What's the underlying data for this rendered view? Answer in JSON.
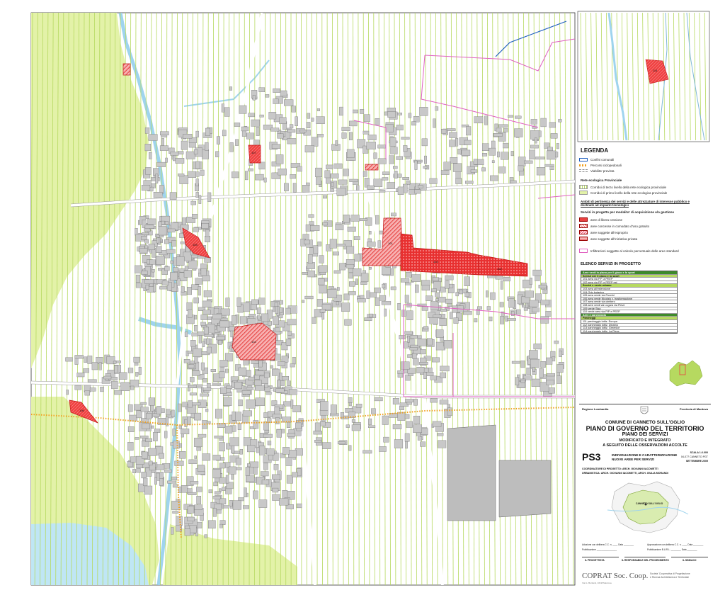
{
  "map": {
    "service_areas": [
      {
        "code": "101",
        "kind": "cessione"
      },
      {
        "code": "102",
        "kind": "cessione"
      },
      {
        "code": "103",
        "kind": "esproprio"
      },
      {
        "code": "104",
        "kind": "esproprio"
      },
      {
        "code": "105",
        "kind": "esproprio"
      },
      {
        "code": "106",
        "kind": "esproprio"
      },
      {
        "code": "107",
        "kind": "esproprio"
      },
      {
        "code": "108",
        "kind": "esproprio"
      },
      {
        "code": "109",
        "kind": "esproprio"
      },
      {
        "code": "110",
        "kind": "esproprio"
      },
      {
        "code": "111",
        "kind": "esproprio"
      },
      {
        "code": "112",
        "kind": "esproprio"
      },
      {
        "code": "113",
        "kind": "esproprio"
      },
      {
        "code": "114",
        "kind": "esproprio"
      }
    ]
  },
  "legend": {
    "title": "LEGENDA",
    "items": [
      {
        "label": "Confini comunali",
        "color": "#1f5fbf",
        "style": "line"
      },
      {
        "label": "Percorsi ciclopedonali",
        "color": "#f0a020",
        "style": "dots"
      },
      {
        "label": "Viabilita' prevista",
        "color": "#bbbbbb",
        "style": "dashed"
      }
    ],
    "ecological_heading": "Rete ecologica Provinciale",
    "ecological_items": [
      {
        "label": "Corridoi di terzo livello della rete ecologica provinciale",
        "color": "#b6d960"
      },
      {
        "label": "Corridoi di primo livello della rete ecologica provinciale",
        "color": "#e3f2a8"
      }
    ],
    "ambiti_heading": "Ambiti di pertinenza dei servizi e delle attrezzature di interesse pubblico e destinate ad impianti tecnologici",
    "servizi_heading": "Servizi in progetto per modalita' di acquisizione e/o gestione",
    "servizi_items": [
      {
        "label": "aree di libera cessione",
        "color": "#e94040"
      },
      {
        "label": "aree concesse in comodato d'uso gratuito",
        "color": "#f29a9a"
      },
      {
        "label": "aree soggette all'esproprio",
        "color": "#f2b5b5"
      },
      {
        "label": "aree soggette all'iniziativa privata",
        "color": "#f7c9c9"
      }
    ],
    "ambiti_standard_label": "Infiltrazioni soggette al calcolo percentuale delle aree standard",
    "ambiti_standard_color": "#e060c0"
  },
  "elenco": {
    "title": "ELENCO SERVIZI IN PROGETTO",
    "rows": [
      {
        "text": "Aree verdi in piano per il gioco e lo sport",
        "kind": "head-dark"
      },
      {
        "text": "Servizi per il gioco e lo sport",
        "kind": "head-light"
      },
      {
        "text": "101 area via P.P. a PEEP",
        "kind": "row"
      },
      {
        "text": "102 area via P.P. e PEEP est",
        "kind": "row"
      },
      {
        "text": "Servizi e verde urbano",
        "kind": "head-light"
      },
      {
        "text": "103 area all'estensione",
        "kind": "row"
      },
      {
        "text": "104 Orto botanico",
        "kind": "row"
      },
      {
        "text": "105 area verde via Puccini",
        "kind": "row"
      },
      {
        "text": "106 area verde Nicolgio v. trasformazione",
        "kind": "row"
      },
      {
        "text": "107 area verde via cimitero",
        "kind": "row"
      },
      {
        "text": "108 aree verdi via Lugura via Pieve",
        "kind": "row"
      },
      {
        "text": "109 verde Sisa",
        "kind": "row"
      },
      {
        "text": "110 verde area via PIP e PEEP",
        "kind": "row"
      },
      {
        "text": "Aree e parcheggio",
        "kind": "head-dark"
      },
      {
        "text": "Parcheggi",
        "kind": "head-light"
      },
      {
        "text": "111 parcheggio lottiz. Europa",
        "kind": "row"
      },
      {
        "text": "112 parcheggio lottiz. Dinamo",
        "kind": "row"
      },
      {
        "text": "113 parcheggio lottiz. Greenice",
        "kind": "row"
      },
      {
        "text": "114 parcheggio lottiz. La Pieve",
        "kind": "row"
      }
    ]
  },
  "title_block": {
    "region": "Regione Lombardia",
    "province": "Provincia di Mantova",
    "comune": "COMUNE DI CANNETO SULL'OGLIO",
    "plan": "PIANO DI GOVERNO DEL TERRITORIO",
    "subplan": "PIANO DEI SERVIZI",
    "modified1": "MODIFICATO E INTEGRATO",
    "modified2": "A SEGUITO DELLE OSSERVAZIONI ACCOLTE",
    "code": "PS3",
    "desc1": "INDIVIDUAZIONE E CARATTERIZZAZIONE",
    "desc2": "NUOVE AREE PER SERVIZI",
    "scale": "SCALA 1:2.000",
    "file": "04-077 CANNETO PGT",
    "date": "SETTEMBRE 2009",
    "credits1": "COORDINATORE DI PROGETTO: ARCH. GIOVANNI IACOMETTI",
    "credits2": "URBANISTICA: ARCH. GIOVANNI IACOMETTI, ARCH. GIULIA MORANDI",
    "place_label": "CANNETO SULL'OGLIO",
    "adozione": "Adozione con delibera C.C. n. ____ Data ________",
    "approvazione": "Approvazione con delibera C.C. n. ____ Data ________",
    "pubblicazione": "Pubblicazione ________________",
    "pubblicazione_burl": "Pubblicazione B.U.R.L. ________ Data ________",
    "sig1": "IL PROGETTISTA",
    "sig2": "IL RESPONSABILE DEL PROCEDIMENTO",
    "sig3": "IL SINDACO",
    "firm": "COPRAT Soc. Coop.",
    "firm_sub1": "Societa' Cooperativa di Progettazione",
    "firm_sub2": "e Ricerca Architettonica e Territoriale",
    "firm_address": "Via G. Bonfanti, 46/48 Mantova"
  },
  "colors": {
    "green_light": "#e3f2a8",
    "green_stripe": "#b6d960",
    "water": "#bfe6f5",
    "building": "#c8c8c8",
    "service_red": "#e94040",
    "boundary_pink": "#e060c0",
    "boundary_blue": "#1f5fbf",
    "cycle_orange": "#f0a020"
  }
}
